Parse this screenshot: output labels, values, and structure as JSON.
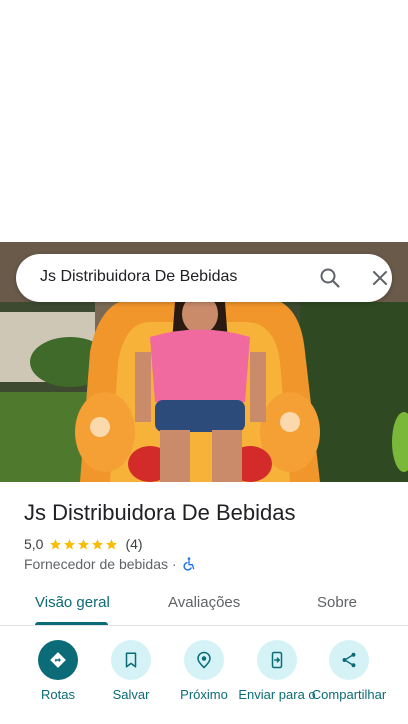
{
  "search": {
    "query": "Js Distribuidora De Bebidas"
  },
  "place": {
    "name": "Js Distribuidora De Bebidas",
    "rating": "5,0",
    "stars": 5,
    "review_count": "(4)",
    "category": "Fornecedor de bebidas",
    "separator": "·"
  },
  "tabs": [
    {
      "label": "Visão geral",
      "active": true
    },
    {
      "label": "Avaliações",
      "active": false
    },
    {
      "label": "Sobre",
      "active": false
    }
  ],
  "actions": [
    {
      "label": "Rotas",
      "icon": "directions-icon"
    },
    {
      "label": "Salvar",
      "icon": "bookmark-icon"
    },
    {
      "label": "Próximo",
      "icon": "nearby-icon"
    },
    {
      "label": "Enviar para o",
      "icon": "send-to-phone-icon"
    },
    {
      "label": "Compartilhar",
      "icon": "share-icon"
    }
  ],
  "colors": {
    "accent": "#0b6b76",
    "action_bg": "#d5f3f7",
    "star": "#fbbc04",
    "accessible": "#1a73e8"
  }
}
